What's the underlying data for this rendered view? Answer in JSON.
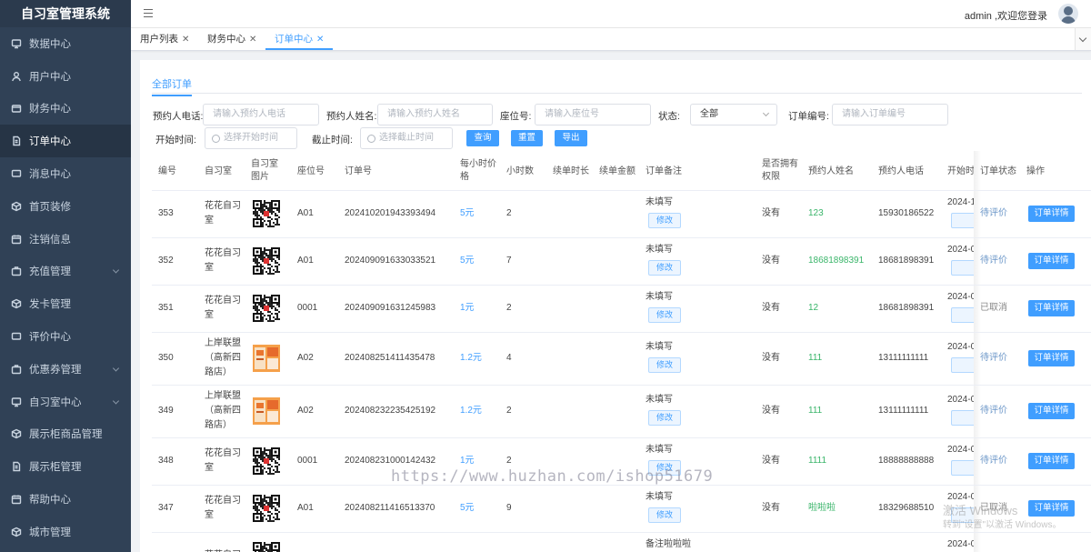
{
  "sidebar": {
    "brand": "自习室管理系统",
    "items": [
      {
        "label": "数据中心",
        "icon": "monitor-icon",
        "arrow": false,
        "active": false
      },
      {
        "label": "用户中心",
        "icon": "user-icon",
        "arrow": false,
        "active": false
      },
      {
        "label": "财务中心",
        "icon": "wallet-icon",
        "arrow": false,
        "active": false
      },
      {
        "label": "订单中心",
        "icon": "document-icon",
        "arrow": false,
        "active": true
      },
      {
        "label": "消息中心",
        "icon": "message-icon",
        "arrow": false,
        "active": false
      },
      {
        "label": "首页装修",
        "icon": "box-icon",
        "arrow": false,
        "active": false
      },
      {
        "label": "注销信息",
        "icon": "calendar-icon",
        "arrow": false,
        "active": false
      },
      {
        "label": "充值管理",
        "icon": "briefcase-icon",
        "arrow": true,
        "active": false
      },
      {
        "label": "发卡管理",
        "icon": "box-icon",
        "arrow": false,
        "active": false
      },
      {
        "label": "评价中心",
        "icon": "message-icon",
        "arrow": false,
        "active": false
      },
      {
        "label": "优惠券管理",
        "icon": "briefcase-icon",
        "arrow": true,
        "active": false
      },
      {
        "label": "自习室中心",
        "icon": "monitor-icon",
        "arrow": true,
        "active": false
      },
      {
        "label": "展示柜商品管理",
        "icon": "box-icon",
        "arrow": false,
        "active": false
      },
      {
        "label": "展示柜管理",
        "icon": "document-icon",
        "arrow": false,
        "active": false
      },
      {
        "label": "帮助中心",
        "icon": "calendar-icon",
        "arrow": false,
        "active": false
      },
      {
        "label": "城市管理",
        "icon": "box-icon",
        "arrow": false,
        "active": false
      }
    ]
  },
  "header": {
    "welcome": "admin ,欢迎您登录"
  },
  "tabs": [
    {
      "label": "用户列表",
      "active": false
    },
    {
      "label": "财务中心",
      "active": false
    },
    {
      "label": "订单中心",
      "active": true
    }
  ],
  "subtab": "全部订单",
  "filters": {
    "phone_label": "预约人电话:",
    "phone_placeholder": "请输入预约人电话",
    "name_label": "预约人姓名:",
    "name_placeholder": "请输入预约人姓名",
    "seat_label": "座位号:",
    "seat_placeholder": "请输入座位号",
    "status_label": "状态:",
    "status_value": "全部",
    "order_label": "订单编号:",
    "order_placeholder": "请输入订单编号",
    "start_label": "开始时间:",
    "start_placeholder": "选择开始时间",
    "end_label": "截止时间:",
    "end_placeholder": "选择截止时间",
    "query_btn": "查询",
    "reset_btn": "重置",
    "export_btn": "导出"
  },
  "columns": {
    "id": "编号",
    "room": "自习室",
    "room_img": "自习室图片",
    "seat": "座位号",
    "order_no": "订单号",
    "price": "每小时价格",
    "hours": "小时数",
    "renew_time": "续单时长",
    "renew_amount": "续单金额",
    "remark": "订单备注",
    "perm": "是否拥有权限",
    "name": "预约人姓名",
    "phone": "预约人电话",
    "start": "开始时间",
    "status": "订单状态",
    "ops": "操作"
  },
  "rows": [
    {
      "id": "353",
      "room": [
        "花花自习",
        "室"
      ],
      "img": "qr",
      "seat": "A01",
      "order_no": "20241020194339349​4",
      "price": "5元",
      "hours": "2",
      "remark": "未填写",
      "modify": "修改",
      "perm": "没有",
      "name": "123",
      "phone": "15930186522",
      "start": "2024-1",
      "status": "待评价",
      "detail": "订单详情"
    },
    {
      "id": "352",
      "room": [
        "花花自习",
        "室"
      ],
      "img": "qr",
      "seat": "A01",
      "order_no": "202409091633033521",
      "price": "5元",
      "hours": "7",
      "remark": "未填写",
      "modify": "修改",
      "perm": "没有",
      "name": "18681898391",
      "phone": "18681898391",
      "start": "2024-0",
      "status": "待评价",
      "detail": "订单详情"
    },
    {
      "id": "351",
      "room": [
        "花花自习",
        "室"
      ],
      "img": "qr",
      "seat": "0001",
      "order_no": "202409091631245983",
      "price": "1元",
      "hours": "2",
      "remark": "未填写",
      "modify": "修改",
      "perm": "没有",
      "name": "12",
      "phone": "18681898391",
      "start": "2024-0",
      "status": "已取消",
      "detail": "订单详情"
    },
    {
      "id": "350",
      "room": [
        "上岸联盟",
        "（高新四",
        "路店）"
      ],
      "img": "poster",
      "seat": "A02",
      "order_no": "202408251411435478",
      "price": "1.2元",
      "hours": "4",
      "remark": "未填写",
      "modify": "修改",
      "perm": "没有",
      "name": "111",
      "phone": "13111111111",
      "start": "2024-0",
      "status": "待评价",
      "detail": "订单详情"
    },
    {
      "id": "349",
      "room": [
        "上岸联盟",
        "（高新四",
        "路店）"
      ],
      "img": "poster",
      "seat": "A02",
      "order_no": "202408232235425192",
      "price": "1.2元",
      "hours": "2",
      "remark": "未填写",
      "modify": "修改",
      "perm": "没有",
      "name": "111",
      "phone": "13111111111",
      "start": "2024-0",
      "status": "待评价",
      "detail": "订单详情"
    },
    {
      "id": "348",
      "room": [
        "花花自习",
        "室"
      ],
      "img": "qr",
      "seat": "0001",
      "order_no": "202408231000142432",
      "price": "1元",
      "hours": "2",
      "remark": "未填写",
      "modify": "修改",
      "perm": "没有",
      "name": "1111",
      "phone": "18888888888",
      "start": "2024-0",
      "status": "待评价",
      "detail": "订单详情"
    },
    {
      "id": "347",
      "room": [
        "花花自习",
        "室"
      ],
      "img": "qr",
      "seat": "A01",
      "order_no": "202408211416513370",
      "price": "5元",
      "hours": "9",
      "remark": "未填写",
      "modify": "修改",
      "perm": "没有",
      "name": "啦啦啦",
      "phone": "18329688510",
      "start": "2024-0",
      "status": "已取消",
      "detail": "订单详情"
    },
    {
      "id": "",
      "room": [
        "花花自习"
      ],
      "img": "qr",
      "seat": "",
      "order_no": "",
      "price": "",
      "hours": "",
      "remark": "备注啦啦啦",
      "modify": "",
      "perm": "",
      "name": "",
      "phone": "",
      "start": "2024-0",
      "status": "",
      "detail": ""
    }
  ],
  "watermark": "https://www.huzhan.com/ishop51679",
  "activate": {
    "line1": "激活 Windows",
    "line2": "转到\"设置\"以激活 Windows。"
  }
}
